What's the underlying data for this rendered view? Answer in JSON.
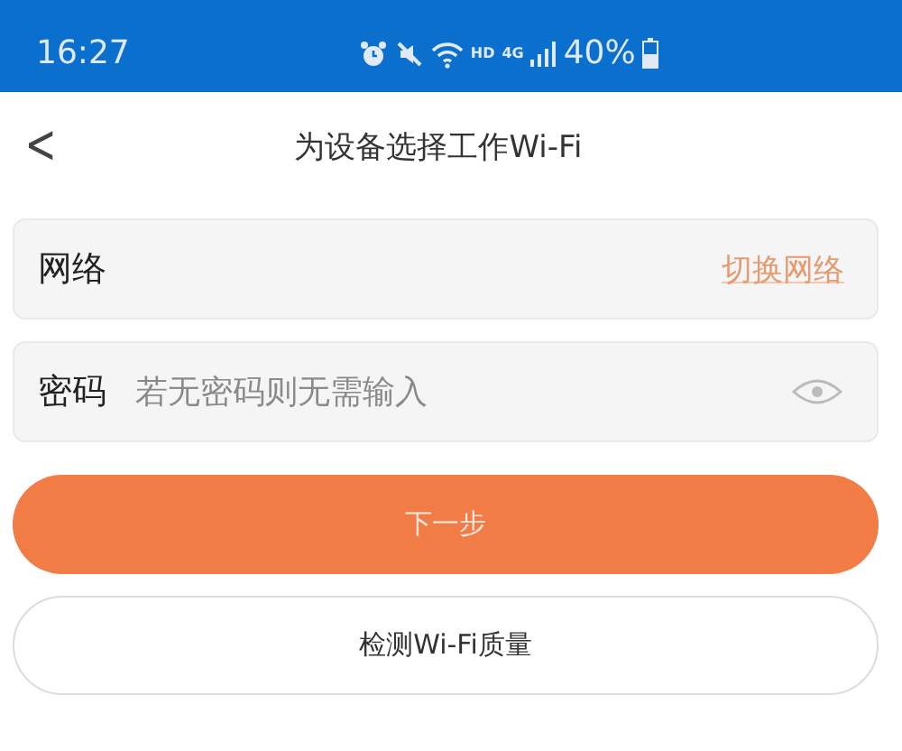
{
  "status_bar": {
    "time": "16:27",
    "hd": "HD",
    "network_type": "4G",
    "battery": "40%"
  },
  "header": {
    "back": "<",
    "title": "为设备选择工作Wi-Fi"
  },
  "network_field": {
    "label": "网络",
    "action": "切换网络"
  },
  "password_field": {
    "label": "密码",
    "placeholder": "若无密码则无需输入"
  },
  "buttons": [
    {
      "kind": "primary",
      "label": "下一步"
    },
    {
      "kind": "outline",
      "label": "检测Wi-Fi质量"
    }
  ]
}
